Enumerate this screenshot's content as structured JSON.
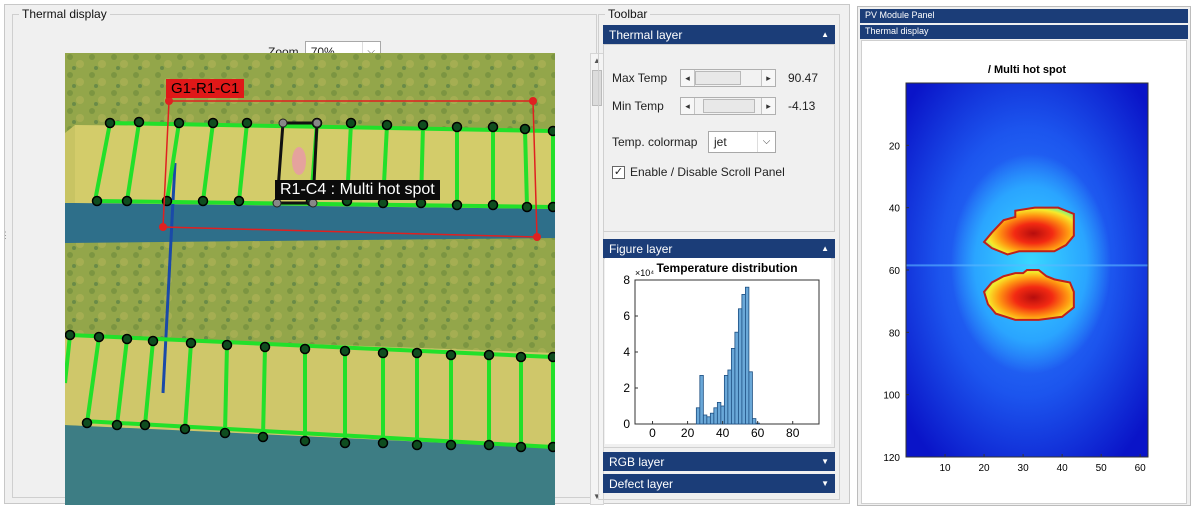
{
  "thermal_display": {
    "title": "Thermal display",
    "zoom_label": "Zoom",
    "zoom_value": "70%",
    "group_label": "G1-R1-C1",
    "hotspot_label": "R1-C4 : Multi hot spot"
  },
  "toolbar": {
    "title": "Toolbar",
    "thermal_layer": {
      "title": "Thermal layer",
      "max_temp_label": "Max Temp",
      "max_temp_value": "90.47",
      "min_temp_label": "Min Temp",
      "min_temp_value": "-4.13",
      "colormap_label": "Temp. colormap",
      "colormap_value": "jet",
      "scroll_checkbox_label": "Enable / Disable Scroll Panel",
      "scroll_checked": true
    },
    "figure_layer": {
      "title": "Figure layer"
    },
    "rgb_layer": {
      "title": "RGB layer"
    },
    "defect_layer": {
      "title": "Defect layer"
    }
  },
  "histogram_chart": {
    "chart_data": {
      "type": "bar",
      "title": "Temperature distribution",
      "y_exponent": "×10⁴",
      "xlim": [
        -10,
        95
      ],
      "ylim": [
        0,
        8
      ],
      "xticks": [
        0,
        20,
        40,
        60,
        80
      ],
      "yticks": [
        0,
        2,
        4,
        6,
        8
      ],
      "bins": [
        {
          "x": 26,
          "y": 0.9
        },
        {
          "x": 28,
          "y": 2.7
        },
        {
          "x": 30,
          "y": 0.5
        },
        {
          "x": 32,
          "y": 0.4
        },
        {
          "x": 34,
          "y": 0.6
        },
        {
          "x": 36,
          "y": 0.9
        },
        {
          "x": 38,
          "y": 1.2
        },
        {
          "x": 40,
          "y": 1.0
        },
        {
          "x": 42,
          "y": 2.7
        },
        {
          "x": 44,
          "y": 3.0
        },
        {
          "x": 46,
          "y": 4.2
        },
        {
          "x": 48,
          "y": 5.1
        },
        {
          "x": 50,
          "y": 6.4
        },
        {
          "x": 52,
          "y": 7.2
        },
        {
          "x": 54,
          "y": 7.6
        },
        {
          "x": 56,
          "y": 2.9
        },
        {
          "x": 58,
          "y": 0.3
        },
        {
          "x": 60,
          "y": 0.05
        }
      ],
      "bar_color": "#6aa8d8"
    }
  },
  "pv_panel": {
    "title": "PV Module Panel",
    "subtitle": "Thermal display",
    "chart_data": {
      "type": "heatmap",
      "title": "/ Multi hot spot",
      "xticks": [
        10,
        20,
        30,
        40,
        50,
        60
      ],
      "yticks": [
        20,
        40,
        60,
        80,
        100,
        120
      ],
      "xlim": [
        0,
        62
      ],
      "ylim": [
        0,
        120
      ],
      "colormap": "jet",
      "hotspot_contour_color": "#c0201a"
    }
  },
  "colors": {
    "header_blue": "#1b3d78",
    "panel_green": "#22e02a",
    "group_box_red": "#e02020",
    "selected_box": "#111111"
  }
}
